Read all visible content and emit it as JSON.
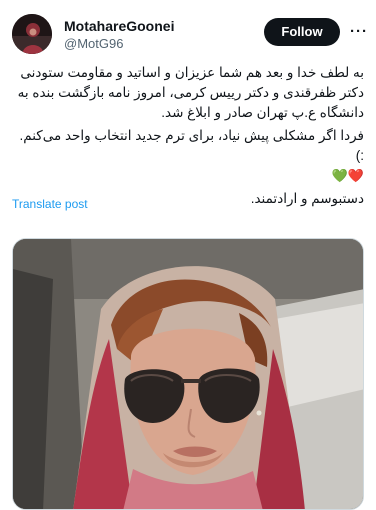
{
  "author": {
    "display_name": "MotahareGoonei",
    "handle": "@MotG96"
  },
  "actions": {
    "follow_label": "Follow",
    "more_label": "···"
  },
  "tweet": {
    "paragraph1": "به لطف خدا و بعد هم شما عزیزان و اساتید و مقاومت ستودنی دکتر ظفرقندی و دکتر رییس کرمی، امروز نامه بازگشت بنده به دانشگاه ع.پ تهران صادر و ابلاغ شد.",
    "paragraph2": "فردا اگر مشکلی پیش نیاد، برای ترم جدید انتخاب واحد می‌کنم. :)",
    "emojis": "❤️💚",
    "paragraph3": "دستبوسم و ارادتمند."
  },
  "translate_label": "Translate post",
  "icons": {
    "more": "more-horizontal-icon"
  },
  "colors": {
    "link": "#1d9bf0",
    "button_bg": "#0f1419",
    "secondary_text": "#536471"
  }
}
